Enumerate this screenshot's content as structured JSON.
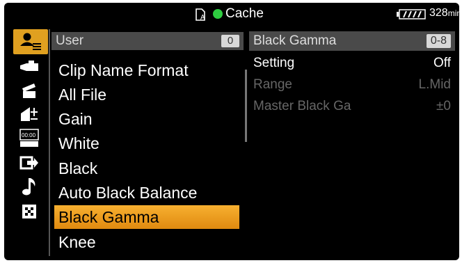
{
  "status": {
    "media_mode": "Cache",
    "remaining_time": "328",
    "remaining_unit": "min"
  },
  "sidebar": {
    "icons": [
      {
        "name": "user-menu-icon",
        "active": true
      },
      {
        "name": "camera-icon",
        "active": false
      },
      {
        "name": "clapper-icon",
        "active": false
      },
      {
        "name": "paint-icon",
        "active": false
      },
      {
        "name": "timecode-icon",
        "active": false
      },
      {
        "name": "output-icon",
        "active": false
      },
      {
        "name": "audio-icon",
        "active": false
      },
      {
        "name": "grid-icon",
        "active": false
      }
    ]
  },
  "menu": {
    "header_label": "User",
    "header_badge": "0",
    "items": [
      {
        "label": "Clip Name Format"
      },
      {
        "label": "All File"
      },
      {
        "label": "Gain"
      },
      {
        "label": "White"
      },
      {
        "label": "Black"
      },
      {
        "label": "Auto Black Balance"
      },
      {
        "label": "Black Gamma",
        "selected": true
      },
      {
        "label": "Knee"
      }
    ]
  },
  "detail": {
    "title": "Black Gamma",
    "badge": "0-8",
    "rows": [
      {
        "key": "Setting",
        "value": "Off",
        "enabled": true
      },
      {
        "key": "Range",
        "value": "L.Mid",
        "enabled": false
      },
      {
        "key": "Master Black Ga",
        "value": "±0",
        "enabled": false
      }
    ]
  },
  "colors": {
    "accent": "#f0a020",
    "record_indicator": "#2ecc40",
    "header_bg": "#4a4a4a"
  }
}
